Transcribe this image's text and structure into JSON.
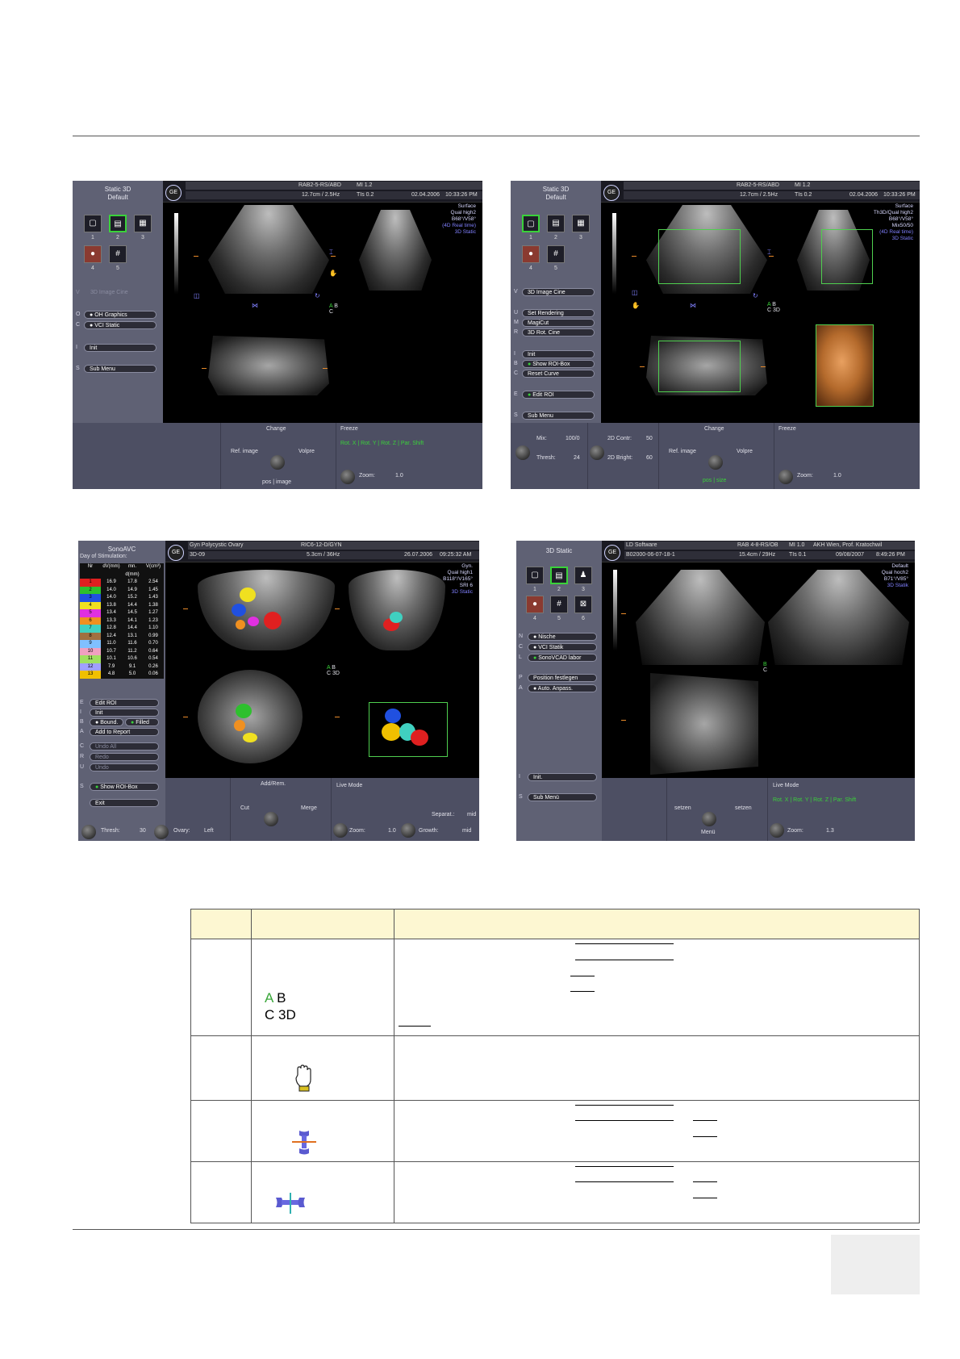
{
  "screens": {
    "top_left": {
      "left_title": [
        "Static 3D",
        "Default"
      ],
      "header_left": "RAB2-5-RS/ABD",
      "header_mi": "MI 1.2",
      "header_freq": "12.7cm / 2.5Hz",
      "header_tis": "TIs 0.2",
      "date": "02.04.2006",
      "time": "10:33:26 PM",
      "right_info": [
        "Surface",
        "Qual high2",
        "B68°/V58°",
        "(4D Real time)",
        "3D Static"
      ],
      "icon_numbers": [
        "1",
        "2",
        "3",
        "4",
        "5"
      ],
      "menu": [
        {
          "key": "V",
          "label": "3D Image Cine"
        },
        {
          "key": "O",
          "label": "OH Graphics"
        },
        {
          "key": "C",
          "label": "VCI Static"
        },
        {
          "key": "I",
          "label": "Init"
        },
        {
          "key": "S",
          "label": "Sub Menu"
        }
      ],
      "ab_labels": [
        "A",
        "B",
        "C"
      ],
      "bottom": {
        "change": "Change",
        "ref_image": "Ref. image",
        "volpre": "Volpre",
        "pos_image": "pos | image",
        "freeze": "Freeze",
        "rot": "Rot. X | Rot. Y | Rot. Z | Par. Shift",
        "zoom_label": "Zoom:",
        "zoom_value": "1.0"
      }
    },
    "top_right": {
      "left_title": [
        "Static 3D",
        "Default"
      ],
      "header_left": "RAB2-5-RS/ABD",
      "header_mi": "MI 1.2",
      "header_freq": "12.7cm / 2.5Hz",
      "header_tis": "TIs 0.2",
      "date": "02.04.2006",
      "time": "10:33:26 PM",
      "right_info": [
        "Surface",
        "Th3D/Qual high2",
        "B68°/V58°",
        "Mix50/50",
        "(4D Real time)",
        "3D Static"
      ],
      "icon_numbers": [
        "1",
        "2",
        "3",
        "4",
        "5"
      ],
      "menu": [
        {
          "key": "V",
          "label": "3D Image Cine"
        },
        {
          "key": "U",
          "label": "Set Rendering"
        },
        {
          "key": "M",
          "label": "MagiCut"
        },
        {
          "key": "R",
          "label": "3D Rot. Cine"
        },
        {
          "key": "I",
          "label": "Init"
        },
        {
          "key": "B",
          "label": "Show ROI-Box"
        },
        {
          "key": "C",
          "label": "Reset Curve"
        },
        {
          "key": "E",
          "label": "Edit ROI"
        },
        {
          "key": "S",
          "label": "Sub Menu"
        }
      ],
      "ab_labels": [
        "A",
        "B",
        "C",
        "3D"
      ],
      "bottom": {
        "mix_label": "Mix:",
        "mix_value": "100/0",
        "thresh_label": "Thresh:",
        "thresh_value": "24",
        "contr_label": "2D Contr:",
        "contr_value": "50",
        "bright_label": "2D Bright:",
        "bright_value": "60",
        "change": "Change",
        "ref_image": "Ref. image",
        "volpre": "Volpre",
        "pos_size": "pos | size",
        "freeze": "Freeze",
        "zoom_label": "Zoom:",
        "zoom_value": "1.0"
      }
    },
    "bottom_left": {
      "left_title": "SonoAVC",
      "stim": "Day of Stimulation:",
      "table_head": [
        "Nr",
        "dV(mm)",
        "mn. d(mm)",
        "V(cm³)"
      ],
      "table_rows": [
        [
          "1",
          "16.9",
          "17.8",
          "2.54"
        ],
        [
          "2",
          "14.0",
          "14.9",
          "1.45"
        ],
        [
          "3",
          "14.0",
          "15.2",
          "1.43"
        ],
        [
          "4",
          "13.8",
          "14.4",
          "1.38"
        ],
        [
          "5",
          "13.4",
          "14.5",
          "1.27"
        ],
        [
          "6",
          "13.3",
          "14.1",
          "1.23"
        ],
        [
          "7",
          "12.8",
          "14.4",
          "1.10"
        ],
        [
          "8",
          "12.4",
          "13.1",
          "0.99"
        ],
        [
          "9",
          "11.0",
          "11.6",
          "0.70"
        ],
        [
          "10",
          "10.7",
          "11.2",
          "0.64"
        ],
        [
          "11",
          "10.1",
          "10.6",
          "0.54"
        ],
        [
          "12",
          "7.9",
          "9.1",
          "0.26"
        ],
        [
          "13",
          "4.8",
          "5.0",
          "0.06"
        ]
      ],
      "row_colors": [
        "#e02020",
        "#2ec02e",
        "#2050e0",
        "#f0e020",
        "#e030e0",
        "#f09020",
        "#40d0c0",
        "#a07040",
        "#80c0ff",
        "#f0a0c0",
        "#a0e060",
        "#a0a0ff",
        "#f0c000"
      ],
      "header_title": "Gyn Polycystic Ovary",
      "header_probe": "RIC6-12-D/GYN",
      "header_mode": "3D-09",
      "header_freq": "5.3cm / 36Hz",
      "date": "26.07.2006",
      "time": "09:25:32 AM",
      "right_info": [
        "Gyn.",
        "Qual high1",
        "B118°/V165°",
        "SRI 6",
        "3D Static"
      ],
      "menu": [
        {
          "key": "E",
          "label": "Edit ROI"
        },
        {
          "key": "I",
          "label": "Init"
        },
        {
          "key": "B",
          "label": "Bound."
        },
        {
          "key": "",
          "label": "Filled"
        },
        {
          "key": "A",
          "label": "Add to Report"
        },
        {
          "key": "C",
          "label": "Undo All"
        },
        {
          "key": "R",
          "label": "Redo"
        },
        {
          "key": "U",
          "label": "Undo"
        },
        {
          "key": "S",
          "label": "Show ROI-Box"
        },
        {
          "key": "",
          "label": "Exit"
        }
      ],
      "ab_labels": [
        "A",
        "B",
        "C",
        "3D"
      ],
      "bottom": {
        "add_rem": "Add/Rem.",
        "cut": "Cut",
        "merge": "Merge",
        "live_mode": "Live Mode",
        "separat_label": "Separat.:",
        "separat_value": "mid",
        "thresh_label": "Thresh:",
        "thresh_value": "30",
        "ovary_label": "Ovary:",
        "ovary_value": "Left",
        "zoom_label": "Zoom:",
        "zoom_value": "1.0",
        "growth_label": "Growth:",
        "growth_value": "mid"
      }
    },
    "bottom_right": {
      "left_title": "3D Static",
      "header_sw": "LD Software",
      "header_probe": "RAB 4-8-RS/OB",
      "header_mi": "MI 1.0",
      "header_site": "AKH Wien, Prof. Kratochwil",
      "header_id": "B02000-06-07-18-1",
      "header_freq": "15.4cm / 29Hz",
      "header_tis": "TIs 0.1",
      "date": "09/08/2007",
      "time": "8:49:26 PM",
      "right_info": [
        "Default",
        "Qual hoch2",
        "B71°/V85°",
        "3D Statik"
      ],
      "icon_numbers": [
        "1",
        "2",
        "3",
        "4",
        "5",
        "6"
      ],
      "menu": [
        {
          "key": "N",
          "label": "Nische"
        },
        {
          "key": "C",
          "label": "VCI Statik"
        },
        {
          "key": "L",
          "label": "SonoVCAD labor"
        },
        {
          "key": "P",
          "label": "Position festlegen"
        },
        {
          "key": "A",
          "label": "Auto. Anpass."
        },
        {
          "key": "I",
          "label": "Init."
        },
        {
          "key": "S",
          "label": "Sub Menü"
        }
      ],
      "ab_labels": [
        "B",
        "C"
      ],
      "bottom": {
        "setzen_l": "setzen",
        "setzen_r": "setzen",
        "menu": "Menü",
        "live_mode": "Live Mode",
        "rot": "Rot. X | Rot. Y | Rot. Z | Par. Shift",
        "zoom_label": "Zoom:",
        "zoom_value": "1.3"
      }
    }
  },
  "table": {
    "row1_label_top": [
      "A",
      "B"
    ],
    "row1_label_bottom": [
      "C",
      "3D"
    ],
    "icons": [
      "hand-icon",
      "rotate-x-icon",
      "rotate-y-icon"
    ]
  },
  "colors": {
    "accent_green": "#3ad23a",
    "header_fill": "#fdf7d2",
    "panel": "#5f6174"
  }
}
